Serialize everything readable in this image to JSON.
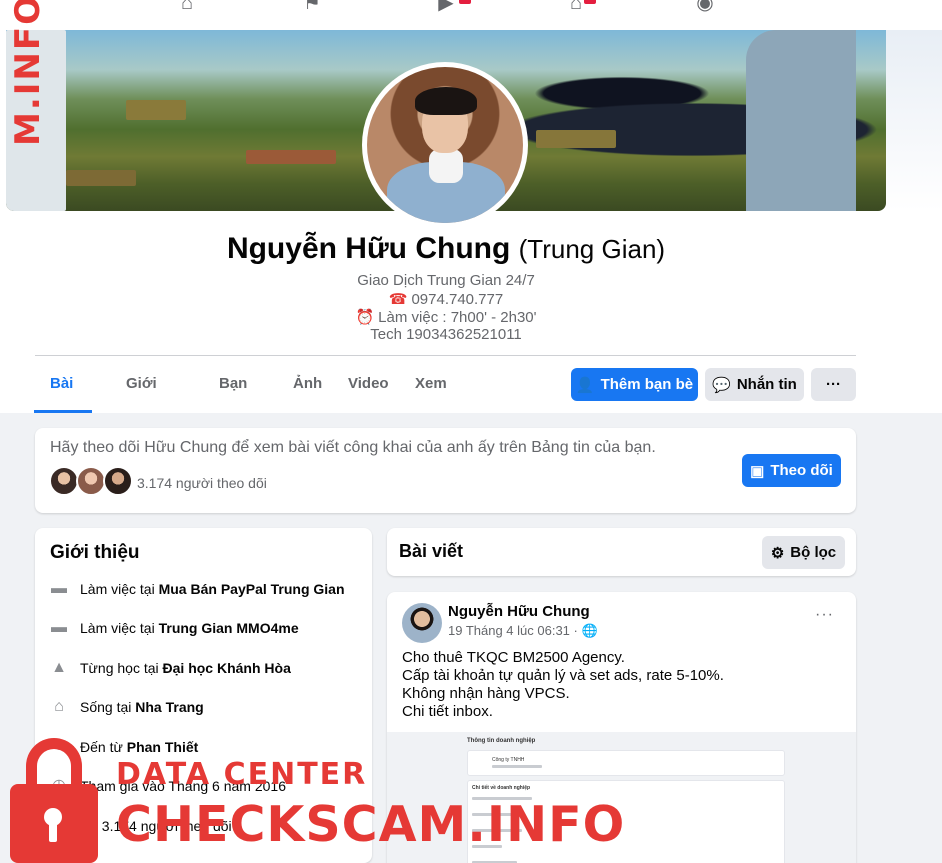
{
  "watermark": {
    "top_text": "M.INFO",
    "data_center": "DATA CENTER",
    "checkscam": "CHECKSCAM.INFO"
  },
  "profile": {
    "name": "Nguyễn Hữu Chung",
    "alternate_name": "(Trung Gian)",
    "bio": {
      "line1": "Giao Dịch Trung Gian 24/7",
      "phone_icon": "☎",
      "phone": "0974.740.777",
      "clock_icon": "⏰",
      "hours": "Làm việc : 7h00' - 2h30'",
      "bank": "Tech 19034362521011"
    }
  },
  "tabs": [
    {
      "label": "Bài viết",
      "active": true
    },
    {
      "label": "Giới thiệu"
    },
    {
      "label": "Bạn bè"
    },
    {
      "label": "Ảnh"
    },
    {
      "label": "Video"
    },
    {
      "label": "Xem thêm"
    }
  ],
  "actions": {
    "add_friend": "Thêm bạn bè",
    "message": "Nhắn tin",
    "more": "···"
  },
  "follow_card": {
    "text": "Hãy theo dõi Hữu Chung để xem bài viết công khai của anh ấy trên Bảng tin của bạn.",
    "followers": "3.174 người theo dõi",
    "follow_button": "Theo dõi"
  },
  "intro": {
    "title": "Giới thiệu",
    "items": [
      {
        "prefix": "Làm việc tại ",
        "bold": "Mua Bán PayPal Trung Gian"
      },
      {
        "prefix": "Làm việc tại ",
        "bold": "Trung Gian MMO4me"
      },
      {
        "prefix": "Từng học tại ",
        "bold": "Đại học Khánh Hòa"
      },
      {
        "prefix": "Sống tại ",
        "bold": "Nha Trang"
      },
      {
        "prefix": "Đến từ ",
        "bold": "Phan Thiết"
      },
      {
        "prefix": "Tham gia vào Tháng 6 năm 2016",
        "bold": ""
      },
      {
        "prefix": "Có 3.174 người theo dõi",
        "bold": ""
      }
    ]
  },
  "posts_header": {
    "title": "Bài viết",
    "filter": "Bộ lọc"
  },
  "post": {
    "author": "Nguyễn Hữu Chung",
    "meta": "19 Tháng 4 lúc 06:31 · ",
    "lines": [
      "Cho thuê TKQC BM2500 Agency.",
      "Cấp tài khoản tự quản lý và set ads, rate 5-10%.",
      "Không nhận hàng VPCS.",
      "Chi tiết inbox."
    ],
    "image": {
      "heading": "Thông tin doanh nghiệp",
      "company": "Công ty TNHH",
      "section": "Chi tiết về doanh nghiệp"
    }
  }
}
